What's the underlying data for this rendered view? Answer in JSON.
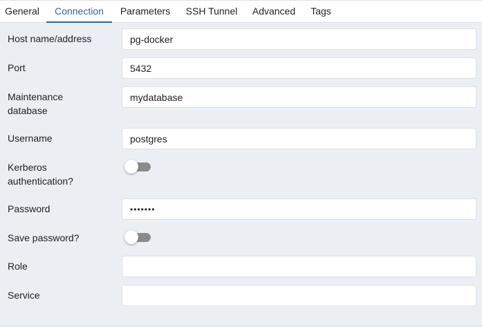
{
  "tabs": [
    {
      "label": "General",
      "active": false
    },
    {
      "label": "Connection",
      "active": true
    },
    {
      "label": "Parameters",
      "active": false
    },
    {
      "label": "SSH Tunnel",
      "active": false
    },
    {
      "label": "Advanced",
      "active": false
    },
    {
      "label": "Tags",
      "active": false
    }
  ],
  "form": {
    "host": {
      "label": "Host name/address",
      "value": "pg-docker"
    },
    "port": {
      "label": "Port",
      "value": "5432"
    },
    "maintenance_db": {
      "label_line1": "Maintenance",
      "label_line2": "database",
      "value": "mydatabase"
    },
    "username": {
      "label": "Username",
      "value": "postgres"
    },
    "kerberos": {
      "label_line1": "Kerberos",
      "label_line2": "authentication?",
      "enabled": false
    },
    "password": {
      "label": "Password",
      "value": "•••••••"
    },
    "save_password": {
      "label": "Save password?",
      "enabled": false
    },
    "role": {
      "label": "Role",
      "value": ""
    },
    "service": {
      "label": "Service",
      "value": ""
    }
  },
  "colors": {
    "accent": "#326690",
    "background": "#ebeef3",
    "toggle_off": "#8b8b8b"
  }
}
